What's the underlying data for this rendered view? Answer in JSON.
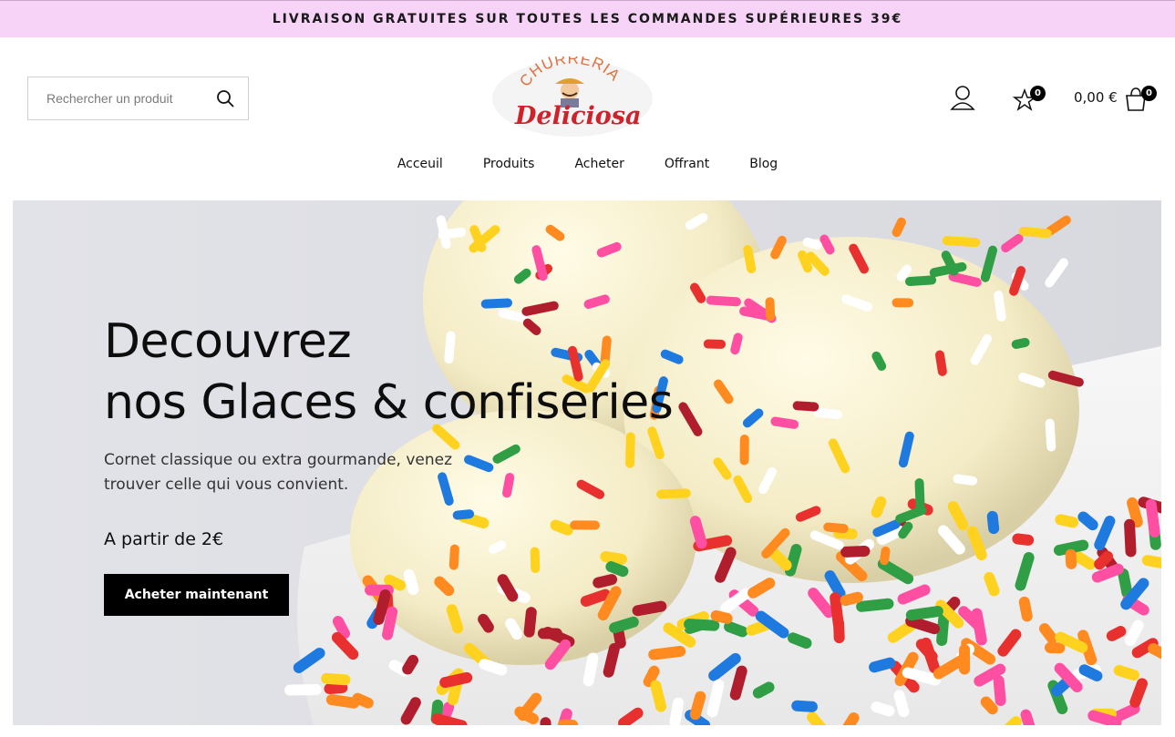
{
  "announcement": "LIVRAISON GRATUITES SUR TOUTES LES COMMANDES SUPÉRIEURES 39€",
  "search": {
    "placeholder": "Rechercher un produit",
    "icon": "search-icon"
  },
  "logo": {
    "line1": "CHURRERIA",
    "line2": "Deliciosa"
  },
  "header": {
    "account_icon": "user-icon",
    "wishlist_icon": "star-icon",
    "wishlist_count": "0",
    "cart_total": "0,00 €",
    "cart_icon": "shopping-bag-icon",
    "cart_count": "0"
  },
  "nav": [
    {
      "label": "Acceuil"
    },
    {
      "label": "Produits"
    },
    {
      "label": "Acheter"
    },
    {
      "label": "Offrant"
    },
    {
      "label": "Blog"
    }
  ],
  "hero": {
    "title_line1": "Decouvrez",
    "title_line2": "nos Glaces & confiseries",
    "subtitle": "Cornet classique ou extra gourmande, venez trouver celle qui vous convient.",
    "price": "A partir de 2€",
    "cta": "Acheter maintenant"
  },
  "colors": {
    "announcement_bg": "#f6d3f7",
    "accent_red": "#d0222b",
    "button_bg": "#000000"
  }
}
